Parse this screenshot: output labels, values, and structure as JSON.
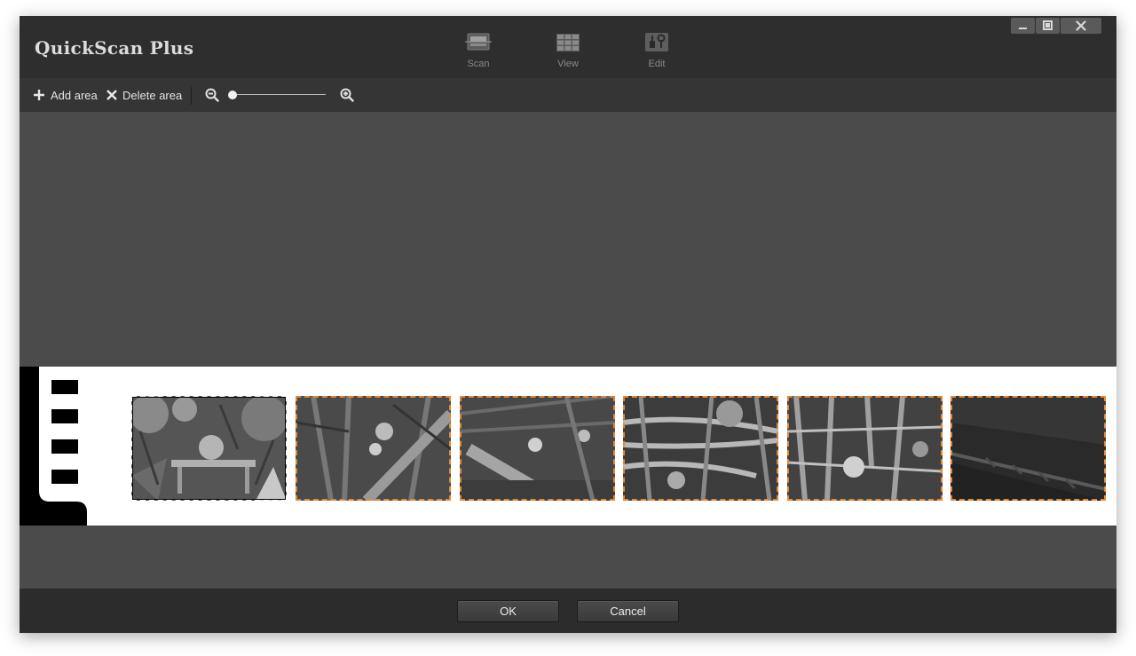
{
  "window": {
    "title": "QuickScan Plus"
  },
  "modes": [
    {
      "label": "Scan",
      "icon": "scanner-icon"
    },
    {
      "label": "View",
      "icon": "grid-view-icon"
    },
    {
      "label": "Edit",
      "icon": "edit-tools-icon"
    }
  ],
  "window_controls": [
    "minimize-icon",
    "maximize-icon",
    "close-icon"
  ],
  "toolbar": {
    "add_area_label": "Add area",
    "delete_area_label": "Delete area",
    "zoom_level_fraction": 0.0
  },
  "filmstrip": {
    "frames": [
      {
        "state": "selected",
        "outline_color": "#ffffff"
      },
      {
        "state": "detected",
        "outline_color": "#e8862f"
      },
      {
        "state": "detected",
        "outline_color": "#e8862f"
      },
      {
        "state": "detected",
        "outline_color": "#e8862f"
      },
      {
        "state": "detected",
        "outline_color": "#e8862f"
      },
      {
        "state": "detected",
        "outline_color": "#e8862f"
      }
    ]
  },
  "footer": {
    "ok_label": "OK",
    "cancel_label": "Cancel"
  },
  "colors": {
    "accent_outline": "#e8862f",
    "titlebar_bg": "#2e2e2e",
    "canvas_bg": "#4b4b4b"
  }
}
